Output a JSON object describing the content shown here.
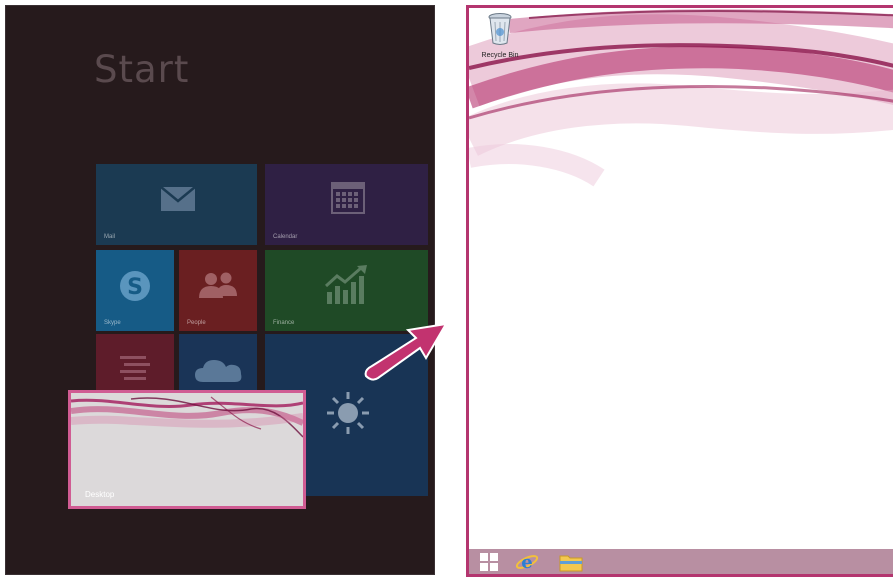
{
  "start_screen": {
    "title": "Start",
    "tiles": [
      {
        "id": "mail",
        "label": "Mail",
        "icon": "mail-icon",
        "color": "#1b3a52"
      },
      {
        "id": "calendar",
        "label": "Calendar",
        "icon": "calendar-icon",
        "color": "#2f2044"
      },
      {
        "id": "skype",
        "label": "Skype",
        "icon": "skype-icon",
        "color": "#165b86"
      },
      {
        "id": "people",
        "label": "People",
        "icon": "people-icon",
        "color": "#6a1f21"
      },
      {
        "id": "finance",
        "label": "Finance",
        "icon": "finance-chart-icon",
        "color": "#1f4a26"
      },
      {
        "id": "reading",
        "label": "",
        "icon": "reading-list-icon",
        "color": "#5e1c2a"
      },
      {
        "id": "onedrive",
        "label": "",
        "icon": "cloud-icon",
        "color": "#1a3457"
      },
      {
        "id": "weather",
        "label": "",
        "icon": "sun-icon",
        "color": "#183455"
      }
    ],
    "desktop_tile": {
      "label": "Desktop",
      "highlight_color": "#d05c93"
    }
  },
  "arrow": {
    "icon": "arrow-right-icon",
    "color": "#c2336f"
  },
  "desktop": {
    "icons": [
      {
        "label": "Recycle Bin",
        "icon": "recycle-bin-icon"
      }
    ],
    "taskbar": {
      "color": "#b88fa2",
      "buttons": [
        {
          "icon": "windows-start-icon"
        },
        {
          "icon": "internet-explorer-icon"
        },
        {
          "icon": "file-explorer-icon"
        }
      ]
    }
  }
}
